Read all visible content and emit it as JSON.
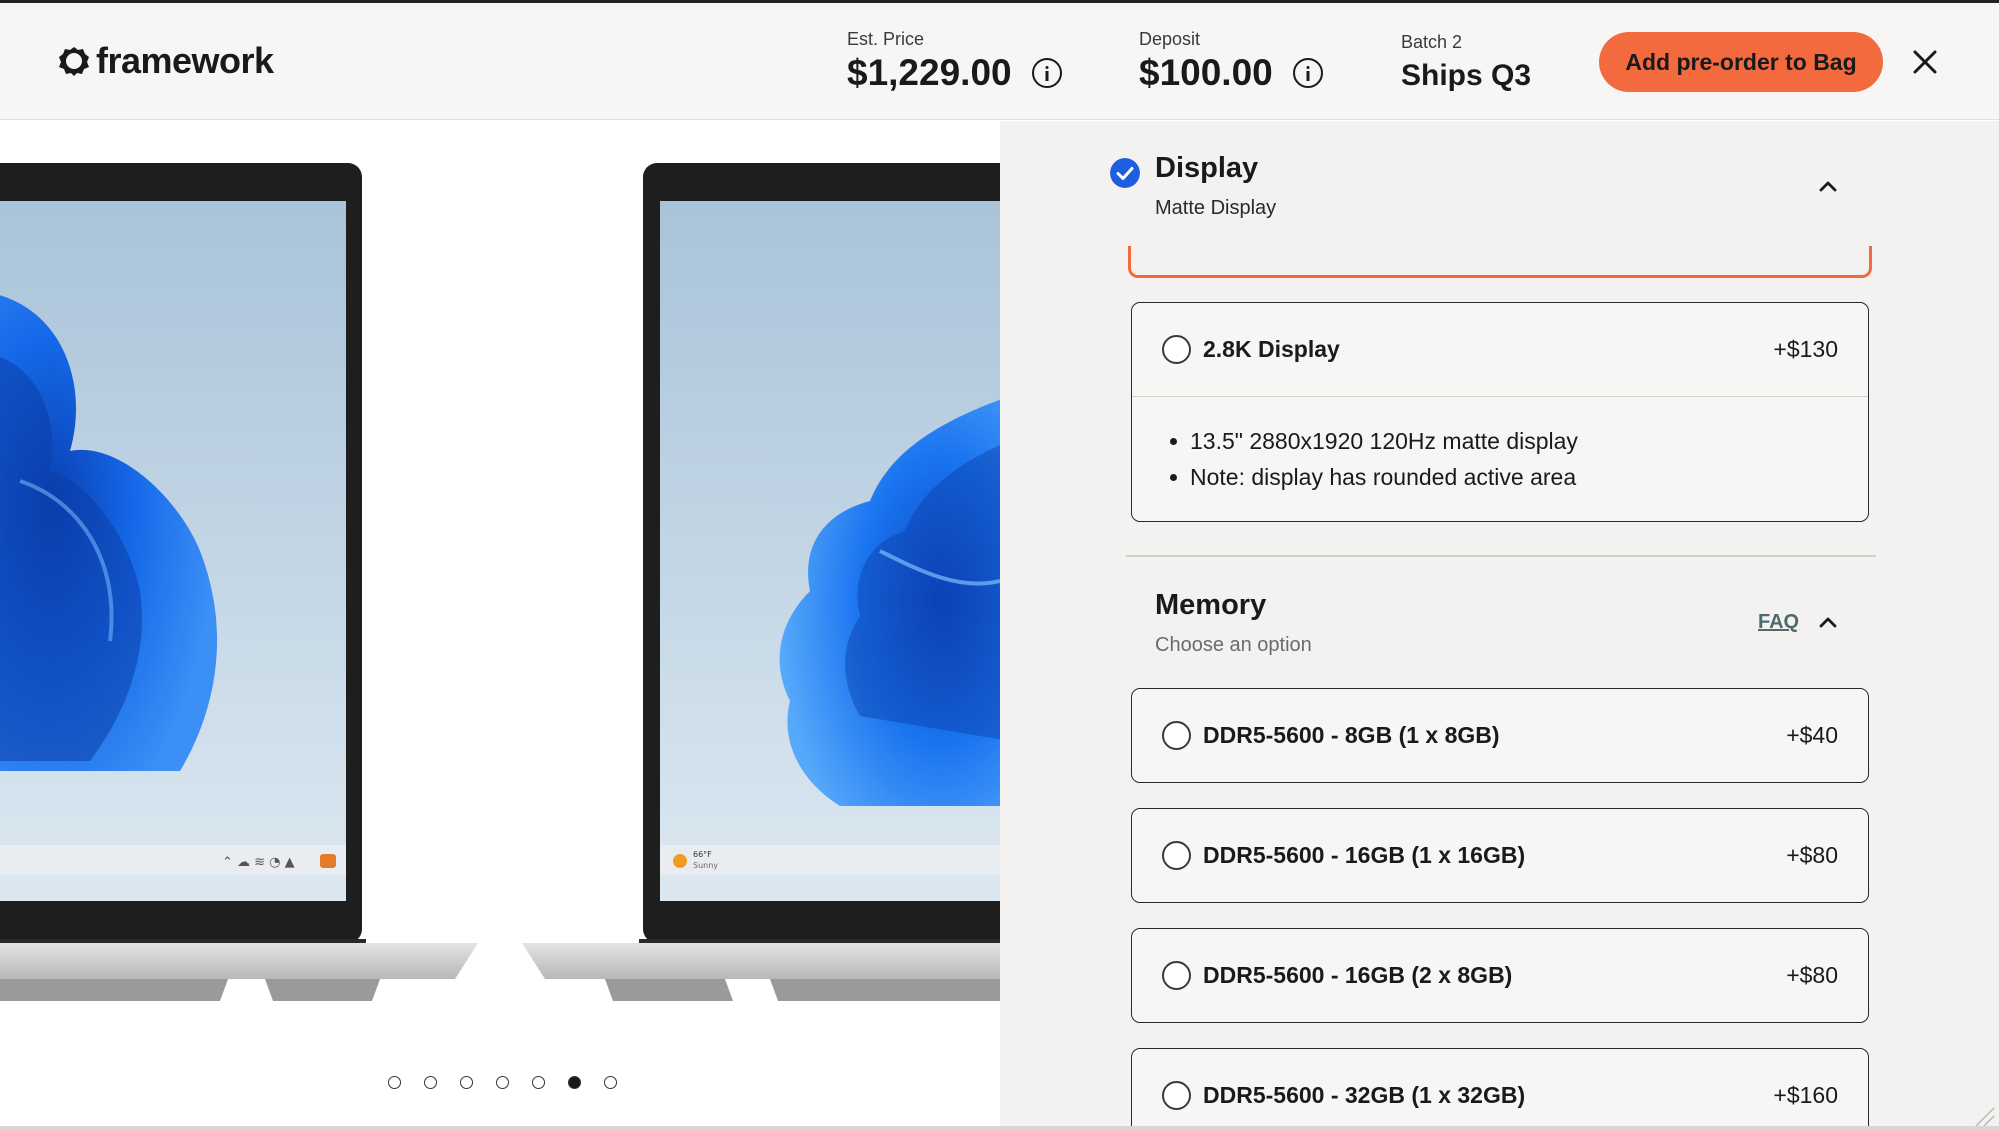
{
  "header": {
    "logo_text": "framework",
    "est_price_label": "Est. Price",
    "est_price_value": "$1,229.00",
    "deposit_label": "Deposit",
    "deposit_value": "$100.00",
    "batch_label": "Batch 2",
    "batch_value": "Ships Q3",
    "cta_label": "Add pre-order to Bag"
  },
  "gallery": {
    "dot_count": 7,
    "active_dot_index": 5,
    "taskbar_weather_temp": "66°F",
    "taskbar_weather_text": "Sunny"
  },
  "display_section": {
    "title": "Display",
    "subtitle": "Matte Display",
    "options": [
      {
        "label": "2.8K Display",
        "price": "+$130",
        "details": [
          "13.5\" 2880x1920 120Hz matte display",
          "Note: display has rounded active area"
        ]
      }
    ]
  },
  "memory_section": {
    "title": "Memory",
    "subtitle": "Choose an option",
    "faq_label": "FAQ",
    "options": [
      {
        "label": "DDR5-5600 - 8GB (1 x 8GB)",
        "price": "+$40"
      },
      {
        "label": "DDR5-5600 - 16GB (1 x 16GB)",
        "price": "+$80"
      },
      {
        "label": "DDR5-5600 - 16GB (2 x 8GB)",
        "price": "+$80"
      },
      {
        "label": "DDR5-5600 - 32GB (1 x 32GB)",
        "price": "+$160"
      }
    ]
  },
  "colors": {
    "accent": "#f26a3d",
    "check_blue": "#1d5fe0",
    "panel_bg": "#f3f2f0"
  }
}
